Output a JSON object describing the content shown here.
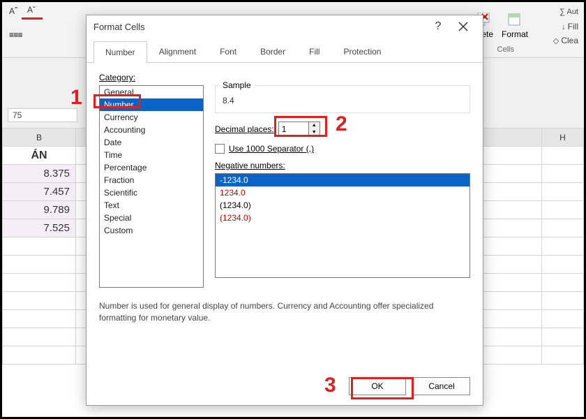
{
  "ribbon": {
    "delete_label": "Delete",
    "format_label": "Format",
    "cells_group": "Cells",
    "sum_label": "∑ Aut",
    "fill_label": "Fill",
    "clear_label": "Clea",
    "font_grow": "A",
    "font_shrink": "A"
  },
  "formula_bar": {
    "value": "75"
  },
  "sheet": {
    "col_header_b": "B",
    "col_header_h": "H",
    "row_header": "ÁN",
    "rows": [
      "8.375",
      "7.457",
      "9.789",
      "7.525"
    ]
  },
  "dialog": {
    "title": "Format Cells",
    "help": "?",
    "tabs": [
      "Number",
      "Alignment",
      "Font",
      "Border",
      "Fill",
      "Protection"
    ],
    "category_label": "Category:",
    "categories": [
      "General",
      "Number",
      "Currency",
      "Accounting",
      "Date",
      "Time",
      "Percentage",
      "Fraction",
      "Scientific",
      "Text",
      "Special",
      "Custom"
    ],
    "selected_category_index": 1,
    "sample_label": "Sample",
    "sample_value": "8.4",
    "decimal_label": "Decimal places:",
    "decimal_value": "1",
    "separator_label": "Use 1000 Separator (,)",
    "negative_label": "Negative numbers:",
    "negative_items": [
      {
        "text": "-1234.0",
        "red": false,
        "selected": true
      },
      {
        "text": "1234.0",
        "red": true,
        "selected": false
      },
      {
        "text": "(1234.0)",
        "red": false,
        "selected": false
      },
      {
        "text": "(1234.0)",
        "red": true,
        "selected": false
      }
    ],
    "description": "Number is used for general display of numbers.  Currency and Accounting offer specialized formatting for monetary value.",
    "ok_label": "OK",
    "cancel_label": "Cancel"
  },
  "annotations": {
    "n1": "1",
    "n2": "2",
    "n3": "3"
  }
}
